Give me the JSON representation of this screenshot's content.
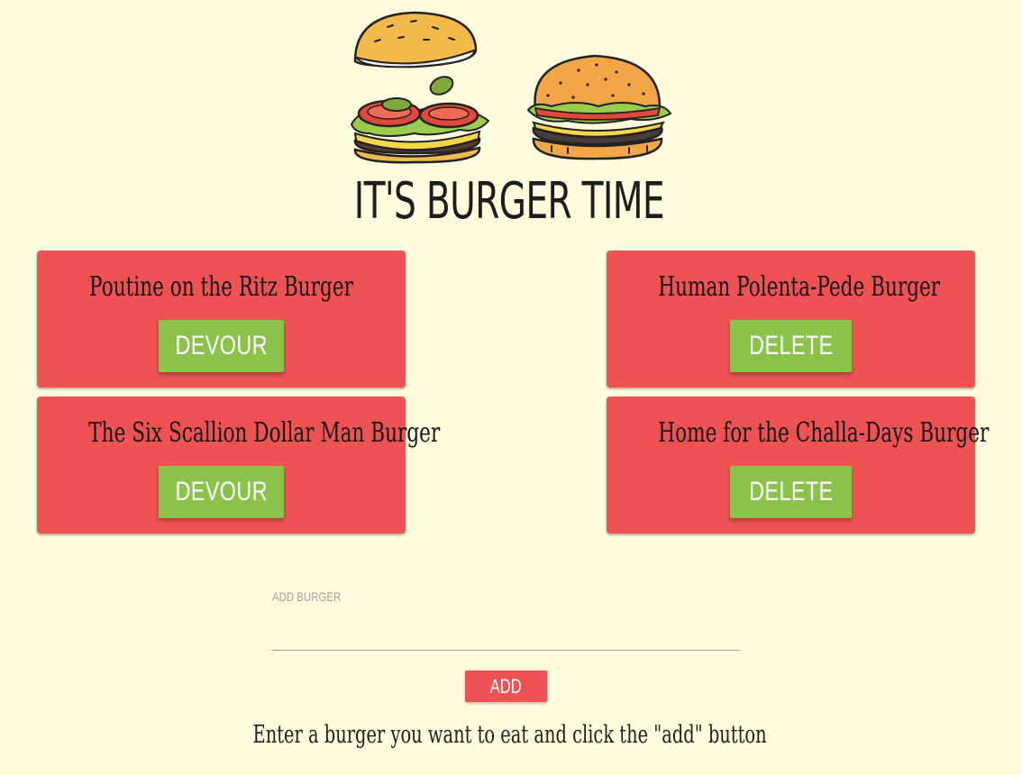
{
  "header": {
    "logo_icon": "burger-illustration-icon",
    "title": "IT'S BURGER TIME"
  },
  "burgers": {
    "uneaten": [
      {
        "name": "Poutine on the Ritz Burger",
        "action": "DEVOUR"
      },
      {
        "name": "The Six Scallion Dollar Man Burger",
        "action": "DEVOUR"
      }
    ],
    "devoured": [
      {
        "name": "Human Polenta-Pede Burger",
        "action": "DELETE"
      },
      {
        "name": "Home for the Challa-Days Burger",
        "action": "DELETE"
      }
    ]
  },
  "form": {
    "label": "ADD BURGER",
    "value": "",
    "button_label": "ADD",
    "helper_text": "Enter a burger you want to eat and click the \"add\" button"
  },
  "colors": {
    "background": "#fefedf",
    "card": "#ee5253",
    "action_button": "#8bc34a",
    "add_button": "#ee5253"
  }
}
